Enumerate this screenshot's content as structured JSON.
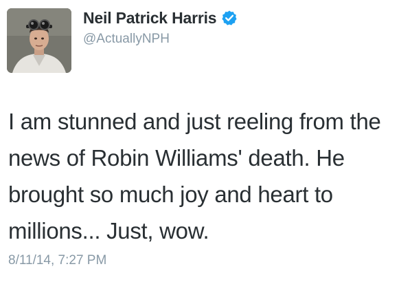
{
  "profile": {
    "display_name": "Neil Patrick Harris",
    "handle": "@ActuallyNPH",
    "verified": true,
    "avatar_icon": "profile-photo"
  },
  "tweet": {
    "text": "I am stunned and just reeling from the news of Robin Williams' death. He brought so much joy and heart to millions... Just, wow.",
    "timestamp": "8/11/14, 7:27 PM"
  },
  "colors": {
    "text": "#292f33",
    "secondary": "#8899a6",
    "verified_badge": "#1da1f2"
  }
}
